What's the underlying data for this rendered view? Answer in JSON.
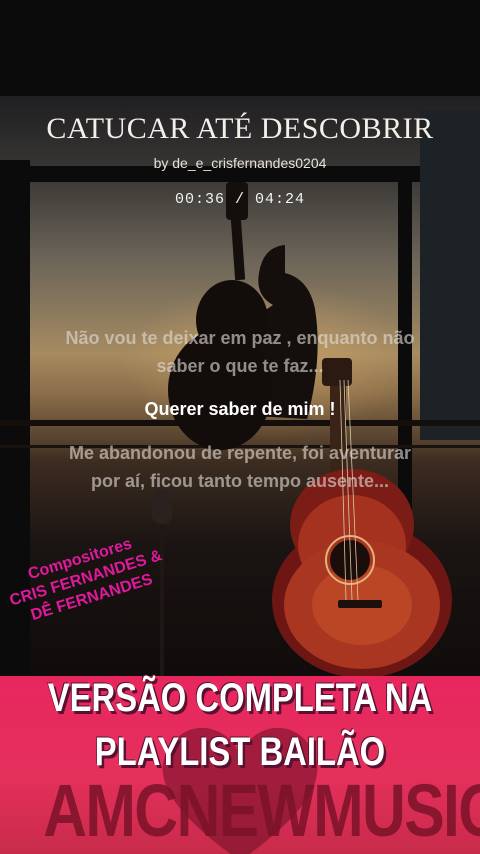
{
  "song": {
    "title": "CATUCAR ATÉ DESCOBRIR",
    "byline": "by de_e_crisfernandes0204",
    "time": "00:36 / 04:24"
  },
  "lyrics": {
    "previous_line1": "Não vou te deixar em paz , enquanto não",
    "previous_line2": "saber o que te faz...",
    "current": "Querer saber de mim !",
    "next_line1": "Me abandonou de repente,  foi aventurar",
    "next_line2": "por aí, ficou tanto tempo ausente..."
  },
  "composers": {
    "heading": "Compositores",
    "name1": "CRIS FERNANDES &",
    "name2": "DÊ FERNANDES"
  },
  "banner": {
    "line1": "VERSÃO COMPLETA NA",
    "line2": "PLAYLIST BAILÃO",
    "brand": "AMCNEWMUSIC"
  },
  "colors": {
    "accent_pink": "#e0199c",
    "banner_red": "#e8265e"
  }
}
